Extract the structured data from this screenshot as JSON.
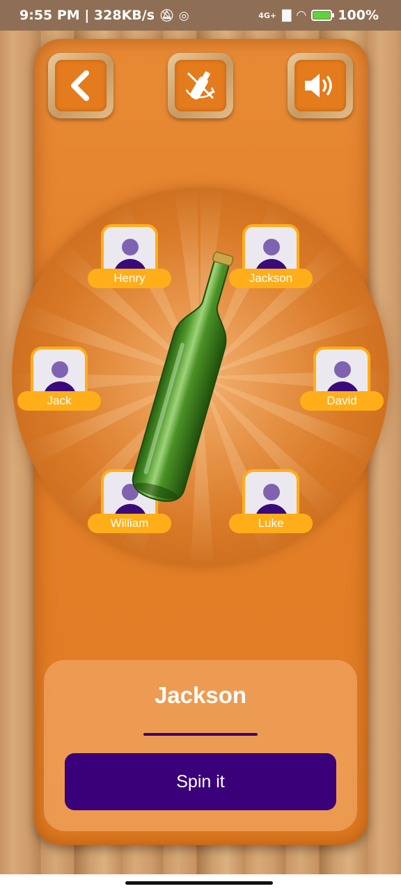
{
  "status_bar": {
    "time": "9:55 PM",
    "speed": "328KB/s",
    "network": "4G+",
    "battery": "100%"
  },
  "toolbar": {
    "back_icon": "chevron-left-icon",
    "bottle_mode_icon": "bottle-off-icon",
    "sound_icon": "speaker-volume-icon"
  },
  "players": [
    {
      "name": "Henry"
    },
    {
      "name": "Jackson"
    },
    {
      "name": "Jack"
    },
    {
      "name": "David"
    },
    {
      "name": "William"
    },
    {
      "name": "Luke"
    }
  ],
  "result": {
    "winner": "Jackson"
  },
  "actions": {
    "spin_label": "Spin it"
  },
  "colors": {
    "board": "#e3802a",
    "pill": "#ffae1a",
    "primary": "#3a0079",
    "bottle": "#3f8a1e"
  }
}
